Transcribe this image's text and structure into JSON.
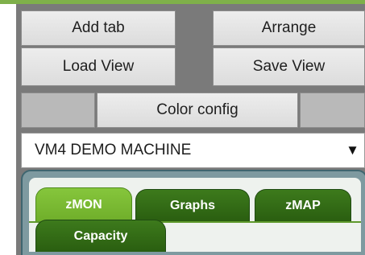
{
  "toolbar": {
    "add_tab": "Add tab",
    "arrange": "Arrange",
    "load_view": "Load View",
    "save_view": "Save View",
    "color_config": "Color config"
  },
  "machine_select": {
    "selected": "VM4 DEMO MACHINE",
    "arrow_icon": "triangle-down-icon"
  },
  "tabs": [
    {
      "label": "zMON",
      "active": true
    },
    {
      "label": "Graphs",
      "active": false
    },
    {
      "label": "zMAP",
      "active": false
    },
    {
      "label": "Capacity",
      "active": false
    }
  ],
  "colors": {
    "active_tab": "#7ab934",
    "inactive_tab": "#2f6414",
    "panel": "#7a7a7a",
    "accent_strip": "#7fb04a"
  }
}
